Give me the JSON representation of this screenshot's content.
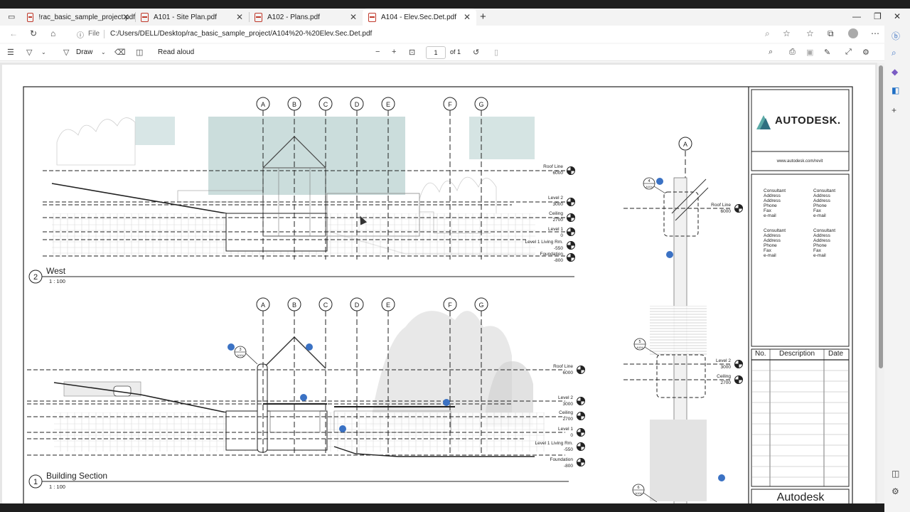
{
  "browser": {
    "tabs": [
      {
        "label": "!rac_basic_sample_project.pdf",
        "active": false
      },
      {
        "label": "A101 - Site Plan.pdf",
        "active": false
      },
      {
        "label": "A102 - Plans.pdf",
        "active": false
      },
      {
        "label": "A104 - Elev.Sec.Det.pdf",
        "active": true
      }
    ],
    "file_label": "File",
    "url": "C:/Users/DELL/Desktop/rac_basic_sample_project/A104%20-%20Elev.Sec.Det.pdf"
  },
  "pdf_toolbar": {
    "draw_label": "Draw",
    "read_aloud_label": "Read aloud",
    "page_number": "1",
    "page_total": "of 1"
  },
  "drawing": {
    "grid_labels": [
      "A",
      "B",
      "C",
      "D",
      "E",
      "F",
      "G"
    ],
    "views": [
      {
        "number": "2",
        "title": "West",
        "scale": "1 : 100",
        "levels": [
          {
            "name": "Roof Line",
            "value": "6000"
          },
          {
            "name": "Level 2",
            "value": "3000"
          },
          {
            "name": "Ceiling",
            "value": "2700"
          },
          {
            "name": "Level 1",
            "value": "0"
          },
          {
            "name": "Level 1 Living Rm.",
            "value": "-550"
          },
          {
            "name": "Foundation",
            "value": "-800"
          }
        ]
      },
      {
        "number": "1",
        "title": "Building Section",
        "scale": "1 : 100",
        "levels": [
          {
            "name": "Roof Line",
            "value": "6000"
          },
          {
            "name": "Level 2",
            "value": "3000"
          },
          {
            "name": "Ceiling",
            "value": "2700"
          },
          {
            "name": "Level 1",
            "value": "0"
          },
          {
            "name": "Level 1 Living Rm.",
            "value": "-550"
          },
          {
            "name": "Foundation",
            "value": "-800"
          }
        ]
      }
    ],
    "detail": {
      "grid_label": "A",
      "levels": [
        {
          "name": "Roof Line",
          "value": "6000"
        },
        {
          "name": "Level 2",
          "value": "3000"
        },
        {
          "name": "Ceiling",
          "value": "2700"
        }
      ],
      "callouts": [
        {
          "number": "4",
          "sheet": "A104"
        },
        {
          "number": "5",
          "sheet": "A104"
        },
        {
          "number": "6",
          "sheet": "A104"
        }
      ]
    },
    "section_callout": {
      "number": "3",
      "sheet": "A104"
    }
  },
  "title_block": {
    "logo": "AUTODESK.",
    "website": "www.autodesk.com/revit",
    "consultants": [
      [
        "Consultant",
        "Address",
        "Address",
        "Phone",
        "Fax",
        "e-mail"
      ],
      [
        "Consultant",
        "Address",
        "Address",
        "Phone",
        "Fax",
        "e-mail"
      ],
      [
        "Consultant",
        "Address",
        "Address",
        "Phone",
        "Fax",
        "e-mail"
      ],
      [
        "Consultant",
        "Address",
        "Address",
        "Phone",
        "Fax",
        "e-mail"
      ]
    ],
    "revision_headers": [
      "No.",
      "Description",
      "Date"
    ],
    "company": "Autodesk"
  },
  "colors": {
    "accent": "#3b72c4",
    "pdf_icon": "#c0392b",
    "vegetation": "#b9d2d0"
  }
}
